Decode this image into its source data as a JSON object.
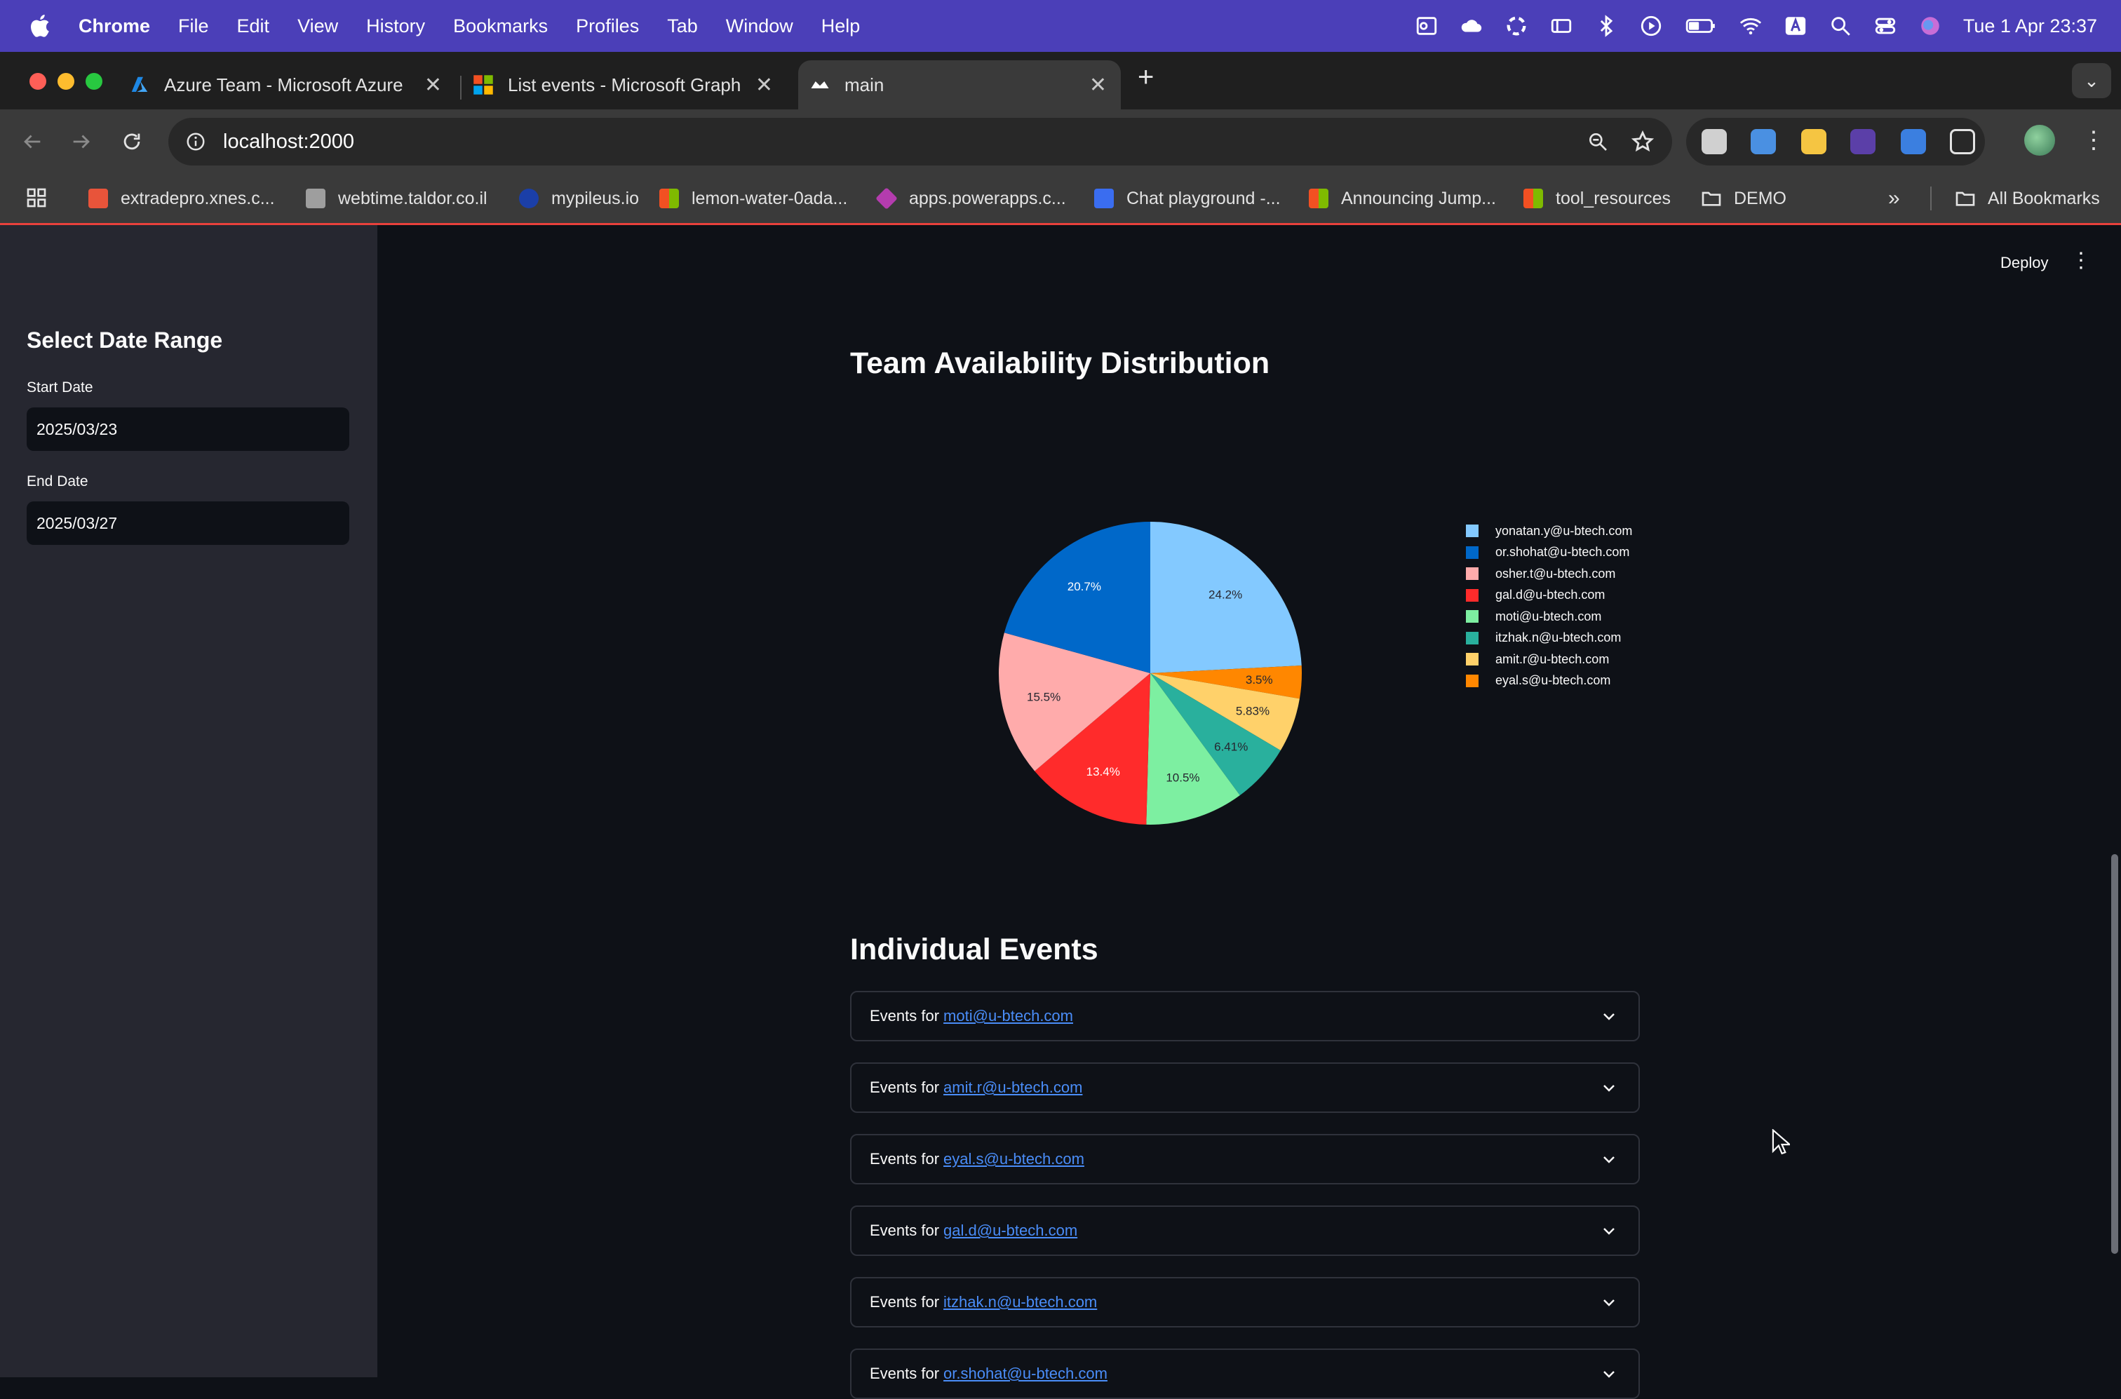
{
  "menubar": {
    "app_name": "Chrome",
    "items": [
      "File",
      "Edit",
      "View",
      "History",
      "Bookmarks",
      "Profiles",
      "Tab",
      "Window",
      "Help"
    ],
    "clock": "Tue 1 Apr  23:37"
  },
  "tabs": [
    {
      "title": "Azure Team - Microsoft Azure",
      "icon": "azure-icon"
    },
    {
      "title": "List events - Microsoft Graph",
      "icon": "microsoft-icon"
    },
    {
      "title": "main",
      "icon": "streamlit-icon",
      "active": true
    }
  ],
  "address_bar": {
    "url": "localhost:2000"
  },
  "bookmarks": [
    {
      "label": "extradepro.xnes.c...",
      "color": "#e8543a"
    },
    {
      "label": "webtime.taldor.co.il",
      "color": "#9e9e9e"
    },
    {
      "label": "mypileus.io",
      "color": "#1b3fa8"
    },
    {
      "label": "lemon-water-0ada...",
      "color": "#f25022"
    },
    {
      "label": "apps.powerapps.c...",
      "color": "#b43cae"
    },
    {
      "label": "Chat playground -...",
      "color": "#3a6df0"
    },
    {
      "label": "Announcing Jump...",
      "color": "#f25022"
    },
    {
      "label": "tool_resources",
      "color": "#f25022"
    },
    {
      "label": "DEMO",
      "color": "folder"
    }
  ],
  "all_bookmarks": "All Bookmarks",
  "app": {
    "deploy_label": "Deploy",
    "sidebar": {
      "title": "Select Date Range",
      "start_label": "Start Date",
      "start_value": "2025/03/23",
      "end_label": "End Date",
      "end_value": "2025/03/27"
    },
    "chart_title": "Team Availability Distribution",
    "events_title": "Individual Events",
    "expander_prefix": "Events for",
    "expanders": [
      "moti@u-btech.com",
      "amit.r@u-btech.com",
      "eyal.s@u-btech.com",
      "gal.d@u-btech.com",
      "itzhak.n@u-btech.com",
      "or.shohat@u-btech.com"
    ]
  },
  "chart_data": {
    "type": "pie",
    "title": "Team Availability Distribution",
    "legend_position": "right",
    "slices": [
      {
        "name": "yonatan.y@u-btech.com",
        "value": 24.2,
        "label": "24.2%",
        "color": "#83c9ff"
      },
      {
        "name": "eyal.s@u-btech.com",
        "value": 3.5,
        "label": "3.5%",
        "color": "#ff8700"
      },
      {
        "name": "amit.r@u-btech.com",
        "value": 5.83,
        "label": "5.83%",
        "color": "#ffd16a"
      },
      {
        "name": "itzhak.n@u-btech.com",
        "value": 6.41,
        "label": "6.41%",
        "color": "#29b09d"
      },
      {
        "name": "moti@u-btech.com",
        "value": 10.5,
        "label": "10.5%",
        "color": "#7defa1"
      },
      {
        "name": "gal.d@u-btech.com",
        "value": 13.4,
        "label": "13.4%",
        "color": "#ff2b2b"
      },
      {
        "name": "osher.t@u-btech.com",
        "value": 15.5,
        "label": "15.5%",
        "color": "#ffabab"
      },
      {
        "name": "or.shohat@u-btech.com",
        "value": 20.7,
        "label": "20.7%",
        "color": "#0068c9"
      }
    ],
    "legend_order": [
      "yonatan.y@u-btech.com",
      "or.shohat@u-btech.com",
      "osher.t@u-btech.com",
      "gal.d@u-btech.com",
      "moti@u-btech.com",
      "itzhak.n@u-btech.com",
      "amit.r@u-btech.com",
      "eyal.s@u-btech.com"
    ]
  }
}
